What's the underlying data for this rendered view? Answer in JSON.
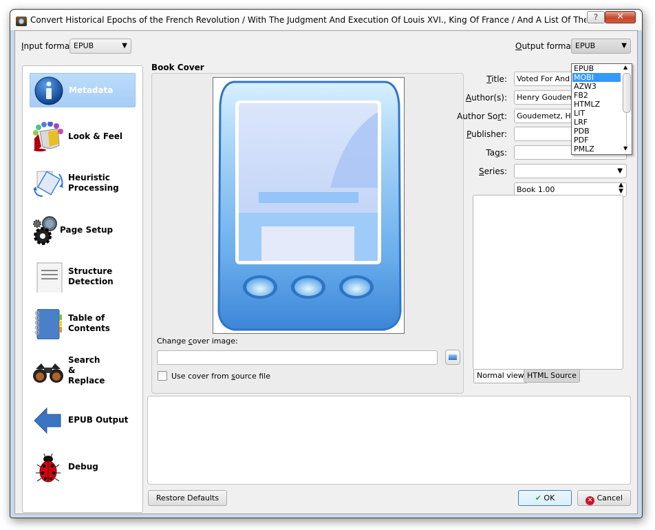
{
  "window": {
    "title": "Convert Historical Epochs of the French Revolution / With The Judgment And Execution Of Louis XVI., King Of France / And A List Of The Members Of...",
    "help_label": "?",
    "close_label": "✕"
  },
  "input_format": {
    "label_accel": "I",
    "label_rest": "nput format:",
    "value": "EPUB"
  },
  "output_format": {
    "label_accel": "O",
    "label_rest": "utput format:",
    "value": "EPUB",
    "options": [
      "EPUB",
      "MOBI",
      "AZW3",
      "FB2",
      "HTMLZ",
      "LIT",
      "LRF",
      "PDB",
      "PDF",
      "PMLZ"
    ],
    "highlighted": "MOBI"
  },
  "sidebar": {
    "items": [
      {
        "label_lines": [
          "Metadata"
        ],
        "icon": "info-icon",
        "active": true
      },
      {
        "label_lines": [
          "Look & Feel"
        ],
        "icon": "paint-bucket-icon",
        "active": false
      },
      {
        "label_lines": [
          "Heuristic",
          "Processing"
        ],
        "icon": "heuristic-rotate-icon",
        "active": false
      },
      {
        "label_lines": [
          "Page Setup"
        ],
        "icon": "gears-icon",
        "active": false
      },
      {
        "label_lines": [
          "Structure",
          "Detection"
        ],
        "icon": "document-lines-icon",
        "active": false
      },
      {
        "label_lines": [
          "Table of",
          "Contents"
        ],
        "icon": "notebook-icon",
        "active": false
      },
      {
        "label_lines": [
          "Search",
          "&",
          "Replace"
        ],
        "icon": "binoculars-icon",
        "active": false
      },
      {
        "label_lines": [
          "EPUB Output"
        ],
        "icon": "arrow-left-icon",
        "active": false
      },
      {
        "label_lines": [
          "Debug"
        ],
        "icon": "ladybug-icon",
        "active": false
      }
    ]
  },
  "cover": {
    "section_title": "Book Cover",
    "change_label_pre": "Change ",
    "change_label_accel": "c",
    "change_label_post": "over image:",
    "path_value": "",
    "use_source_pre": "Use cover from ",
    "use_source_accel": "s",
    "use_source_post": "ource file",
    "use_source_checked": false
  },
  "metadata": {
    "title": {
      "label_accel": "T",
      "label_rest": "itle:",
      "value": "Voted For And A"
    },
    "authors": {
      "label_accel": "A",
      "label_rest": "uthor(s):",
      "value": "Henry Goudeme"
    },
    "author_sort": {
      "label_pre": "Author So",
      "label_accel": "r",
      "label_post": "t:",
      "value": "Goudemetz, Her"
    },
    "publisher": {
      "label_accel": "P",
      "label_rest": "ublisher:",
      "value": ""
    },
    "tags": {
      "label_pre": "Ta",
      "label_accel": "g",
      "label_post": "s:",
      "value": ""
    },
    "series": {
      "label_accel": "S",
      "label_rest": "eries:",
      "value": ""
    },
    "series_index": "Book 1.00"
  },
  "comments": {
    "tabs": [
      "Normal view",
      "HTML Source"
    ],
    "active_tab": "Normal view"
  },
  "buttons": {
    "restore_defaults": "Restore Defaults",
    "ok": "OK",
    "cancel": "Cancel"
  }
}
